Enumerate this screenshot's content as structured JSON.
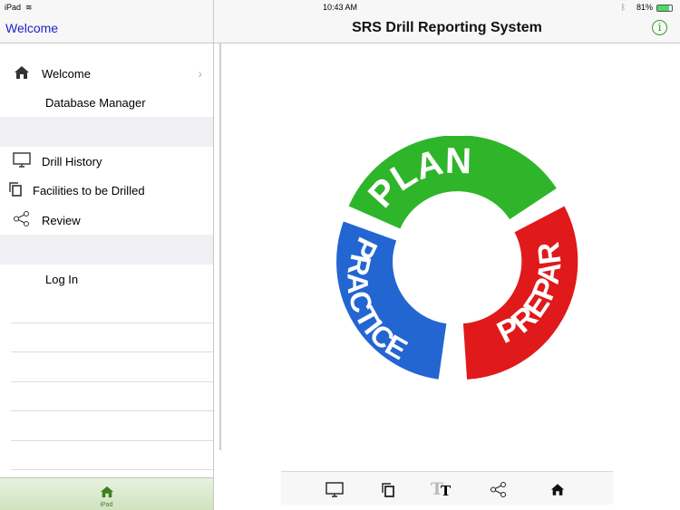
{
  "status": {
    "device": "iPad",
    "time": "10:43 AM",
    "battery": "81%"
  },
  "nav": {
    "back_label": "Welcome",
    "title": "SRS Drill Reporting System",
    "info_icon": "info-icon"
  },
  "sidebar": {
    "items": [
      {
        "label": "Welcome",
        "icon": "home-icon"
      },
      {
        "label": "Database Manager"
      },
      {
        "label": "Drill History",
        "icon": "monitor-icon"
      },
      {
        "label": "Facilities to be Drilled",
        "icon": "copy-icon"
      },
      {
        "label": "Review",
        "icon": "share-icon"
      },
      {
        "label": "Log In"
      }
    ]
  },
  "tabbar": {
    "label": "iPad",
    "icon": "home-icon"
  },
  "logo": {
    "words": [
      "PLAN",
      "PREPARE",
      "PRACTICE"
    ],
    "colors": {
      "plan": "#2fb52a",
      "prepare": "#e0191b",
      "practice": "#2366d1"
    }
  },
  "toolbar": {
    "icons": [
      "monitor-icon",
      "copy-icon",
      "text-size-icon",
      "share-icon",
      "home-icon"
    ]
  },
  "colors": {
    "accent": "#2222cc",
    "info": "#3a9a2a"
  }
}
